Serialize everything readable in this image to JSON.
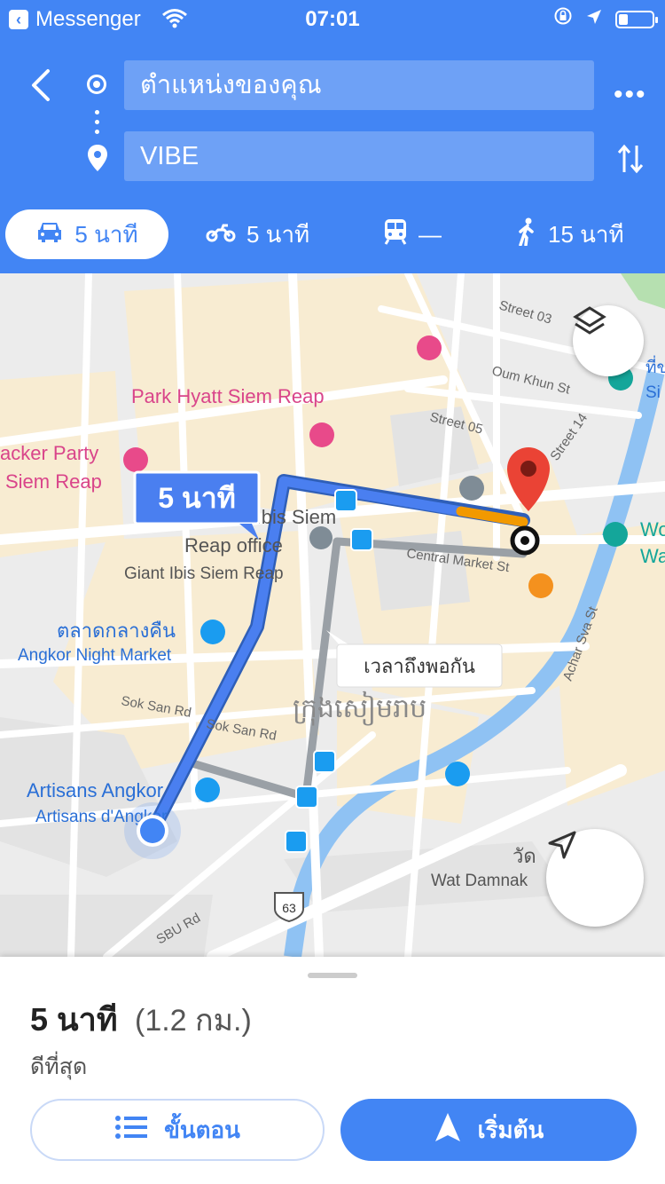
{
  "status_bar": {
    "back_app": "Messenger",
    "time": "07:01"
  },
  "header": {
    "origin_text": "ตำแหน่งของคุณ",
    "destination_text": "VIBE",
    "more_label": "•••"
  },
  "modes": [
    {
      "name": "car",
      "label": "5 นาที"
    },
    {
      "name": "motorbike",
      "label": "5 นาที"
    },
    {
      "name": "transit",
      "label": "—"
    },
    {
      "name": "walk",
      "label": "15 นาที"
    }
  ],
  "map": {
    "route_badge": "5 นาที",
    "same_time_tooltip": "เวลาถึงพอกัน",
    "labels": {
      "street_03": "Street 03",
      "oum_khun": "Oum Khun St",
      "street_05": "Street 05",
      "street_14": "Street 14",
      "park_hyatt": "Park Hyatt Siem Reap",
      "backer_party_1": "acker Party",
      "backer_party_2": "Siem Reap",
      "giant_ibis_office_1": "Giant Ibis Siem",
      "giant_ibis_office_2": "Reap office",
      "giant_ibis": "Giant Ibis Siem Reap",
      "central_market": "Central Market St",
      "night_market_th": "ตลาดกลางคืน",
      "night_market_en": "Angkor Night Market",
      "sok_san_1": "Sok San Rd",
      "sok_san_2": "Sok San Rd",
      "khmer_city": "ក្រុងសៀមរាប",
      "achar_sva": "Achar Sva St",
      "artisans_1": "Artisans Angkor",
      "artisans_2": "Artisans d'Angkor",
      "wat_th": "วัด",
      "wat_damnak": "Wat Damnak",
      "route_63": "63",
      "sbu_rd": "SBU Rd",
      "right_th": "ที่ข",
      "right_si": "Si",
      "right_wo": "Wo",
      "right_wa": "Wa"
    }
  },
  "summary": {
    "eta": "5 นาที",
    "distance": "(1.2 กม.)",
    "note": "ดีที่สุด",
    "steps_label": "ขั้นตอน",
    "start_label": "เริ่มต้น"
  },
  "colors": {
    "accent": "#4285f4",
    "route": "#4a7ff0",
    "alt_route": "#9aa0a6",
    "traffic": "#f29900",
    "pin": "#ea4335"
  }
}
